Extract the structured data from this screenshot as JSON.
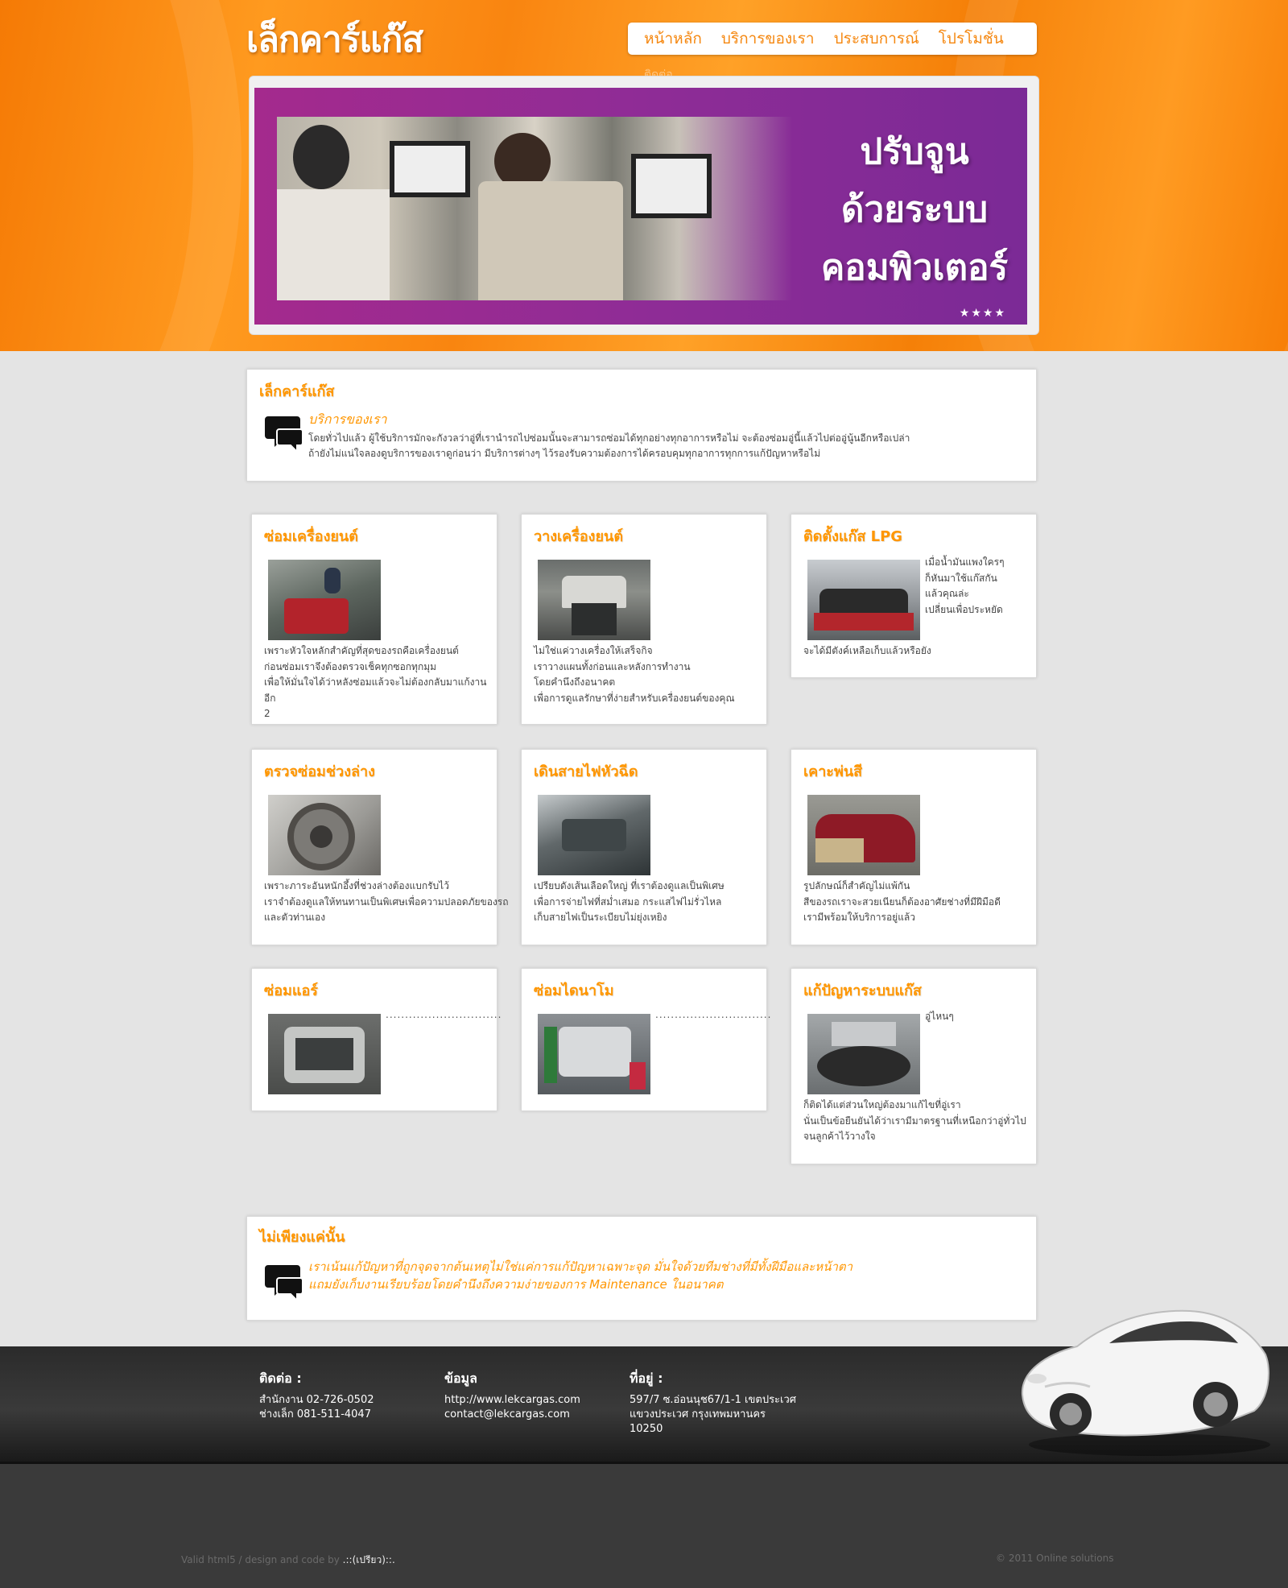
{
  "header": {
    "logo": "เล็กคาร์แก๊ส",
    "nav": [
      "หน้าหลัก",
      "บริการของเรา",
      "ประสบการณ์",
      "โปรโมชั่น"
    ],
    "nav_overflow": "ติดต่อ"
  },
  "banner": {
    "lines": [
      "ปรับจูน",
      "ด้วยระบบ",
      "คอมพิวเตอร์"
    ],
    "dots": "★★★★"
  },
  "intro": {
    "title": "เล็กคาร์แก๊ส",
    "subtitle": "บริการของเรา",
    "text_1": "โดยทั่วไปแล้ว           ผู้ใช้บริการมักจะกังวลว่าอู่ที่เรานำรถไปซ่อมนั้นจะสามารถซ่อมได้ทุกอย่างทุกอาการหรือไม่          จะต้องซ่อมอู่นี้แล้วไปต่ออู่นู้นอีกหรือเปล่า",
    "text_2": "ถ้ายังไม่แน่ใจลองดูบริการของเราดูก่อนว่า มีบริการต่างๆ ไว้รองรับความต้องการได้ครอบคุมทุกอาการทุกการแก้ปัญหาหรือไม่"
  },
  "services": [
    {
      "title": "ซ่อมเครื่องยนต์",
      "lines": [
        "เพราะหัวใจหลักสำคัญที่สุดของรถคือเครื่องยนต์",
        "ก่อนซ่อมเราจึงต้องตรวจเช็คทุกซอกทุกมุม",
        "เพื่อให้มั่นใจได้ว่าหลังซ่อมแล้วจะไม่ต้องกลับมาแก้งานอีก",
        "2"
      ]
    },
    {
      "title": "วางเครื่องยนต์",
      "lines": [
        "ไม่ใช่แค่วางเครื่องให้เสร็จกิจ",
        "เราวางแผนทั้งก่อนและหลังการทำงาน",
        "โดยคำนึงถึงอนาคต",
        "เพื่อการดูแลรักษาที่ง่ายสำหรับเครื่องยนต์ของคุณ"
      ]
    },
    {
      "title": "ติดตั้งแก๊ส LPG",
      "side": [
        "เมื่อน้ำมันแพงใครๆ",
        "ก็หันมาใช้แก๊สกัน",
        "แล้วคุณล่ะ",
        "เปลี่ยนเพื่อประหยัด"
      ],
      "lines": [
        "จะได้มีตังค์เหลือเก็บแล้วหรือยัง"
      ]
    },
    {
      "title": "ตรวจซ่อมช่วงล่าง",
      "lines": [
        "เพราะภาระอันหนักอึ้งที่ช่วงล่างต้องแบกรับไว้",
        "เราจำต้องดูแลให้ทนทานเป็นพิเศษเพื่อความปลอดภัยของรถ",
        "และตัวท่านเอง"
      ]
    },
    {
      "title": "เดินสายไฟหัวฉีด",
      "lines": [
        "เปรียบดังเส้นเลือดใหญ่   ที่เราต้องดูแลเป็นพิเศษ",
        "เพื่อการจ่ายไฟที่สม่ำเสมอ     กระแสไฟไม่รั่วไหล",
        "เก็บสายไฟเป็นระเบียบไม่ยุ่งเหยิง"
      ]
    },
    {
      "title": "เคาะพ่นสี",
      "lines": [
        "รูปลักษณ์ก็สำคัญไม่แพ้กัน",
        "สีของรถเราจะสวยเนียนก็ต้องอาศัยช่างที่มีฝีมือดี",
        "เรามีพร้อมให้บริการอยู่แล้ว"
      ]
    },
    {
      "title": "ซ่อมแอร์",
      "side": [
        ".............................."
      ],
      "lines": []
    },
    {
      "title": "ซ่อมไดนาโม",
      "side": [
        ".............................."
      ],
      "lines": []
    },
    {
      "title": "แก้ปัญหาระบบแก๊ส",
      "side": [
        "อู่ไหนๆ"
      ],
      "lines": [
        "ก็ติดได้แต่ส่วนใหญ่ต้องมาแก้ไขที่อู่เรา",
        "นั่นเป็นข้อยืนยันได้ว่าเรามีมาตรฐานที่เหนือกว่าอู่ทั่วไป",
        "จนลูกค้าไว้วางใจ"
      ]
    }
  ],
  "more": {
    "title": "ไม่เพียงแค่นั้น",
    "text_1": "เราเน้นแก้ปัญหาที่ถูกจุดจากต้นเหตุไม่ใช่แค่การแก้ปัญหาเฉพาะจุด มั่นใจด้วยทีมช่างที่มีทั้งฝีมือและหน้าตา",
    "text_2": "แถมยังเก็บงานเรียบร้อยโดยคำนึงถึงความง่ายของการ Maintenance ในอนาคต"
  },
  "footer": {
    "contact_title": "ติดต่อ :",
    "contact_office": "สำนักงาน 02-726-0502",
    "contact_lek": "ช่างเล็ก 081-511-4047",
    "info_title": "ข้อมูล",
    "info_web": "http://www.lekcargas.com",
    "info_email": "contact@lekcargas.com",
    "address_title": "ที่อยู่ :",
    "address_1": "597/7 ซ.อ่อนนุช67/1-1 เขตประเวศ",
    "address_2": "แขวงประเวศ กรุงเทพมหานคร",
    "address_3": "10250"
  },
  "bottom": {
    "credit_prefix": "Valid html5 / design and code by ",
    "credit_name": ".::(เปรียว)::.",
    "copyright": "© 2011 Online solutions"
  },
  "colors": {
    "accent": "#ff9600",
    "banner_purple": "#8f2c96",
    "footer": "#333333"
  }
}
